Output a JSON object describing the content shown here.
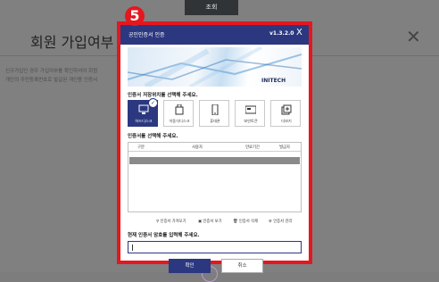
{
  "background": {
    "top_button_label": "조회",
    "title": "회원 가입여부 확",
    "lines": [
      "신규가입인 경우 가입여부를 확인하셔야 회원",
      "개인의 주민등록번호로 발급된 개인용 인증서"
    ]
  },
  "step_badge": "5",
  "dialog": {
    "title": "공인인증서 인증",
    "version": "v1.3.2.0",
    "close_label": "X",
    "brand": "INITECH",
    "storage_prompt": "인증서 저장위치를 선택해 주세요.",
    "storage_options": [
      {
        "label": "하드디스크",
        "icon": "hard-disk-icon",
        "selected": true
      },
      {
        "label": "이동식디스크",
        "icon": "removable-disk-icon",
        "selected": false
      },
      {
        "label": "휴대폰",
        "icon": "mobile-phone-icon",
        "selected": false
      },
      {
        "label": "보안토큰",
        "icon": "security-token-icon",
        "selected": false
      },
      {
        "label": "더보기",
        "icon": "more-icon",
        "selected": false
      }
    ],
    "cert_prompt": "인증서를 선택해 주세요.",
    "table_headers": [
      "구분",
      "사용자",
      "만료기간",
      "발급자"
    ],
    "actions": [
      "인증서 가져오기",
      "인증서 보기",
      "인증서 삭제",
      "인증서 관리"
    ],
    "password_prompt": "현재 인증서 암호를 입력해 주세요.",
    "password_value": "",
    "ok_label": "확인",
    "cancel_label": "취소"
  },
  "colors": {
    "accent": "#2b3880",
    "highlight": "#e4171f"
  }
}
